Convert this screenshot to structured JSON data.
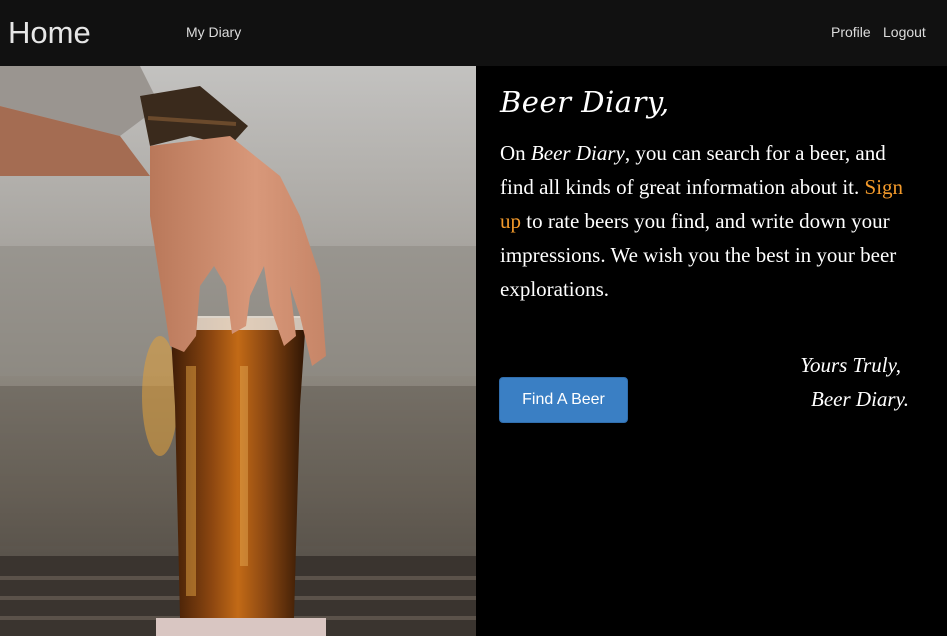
{
  "navbar": {
    "brand": "Home",
    "links": {
      "my_diary": "My Diary",
      "profile": "Profile",
      "logout": "Logout"
    }
  },
  "hero": {
    "title": "Beer Diary,",
    "intro": {
      "prefix": "On ",
      "site_name": "Beer Diary",
      "part1": ", you can search for a beer, and find all kinds of great information about it. ",
      "signup_link": "Sign up",
      "part2": " to rate beers you find, and write down your impressions. We wish you the best in your beer explorations."
    },
    "signature": {
      "closing": "Yours Truly,",
      "name": "Beer Diary."
    },
    "find_button": "Find A Beer"
  },
  "colors": {
    "navbar_bg": "#111111",
    "accent_link": "#f39a2b",
    "button_bg": "#3a7fc4"
  }
}
